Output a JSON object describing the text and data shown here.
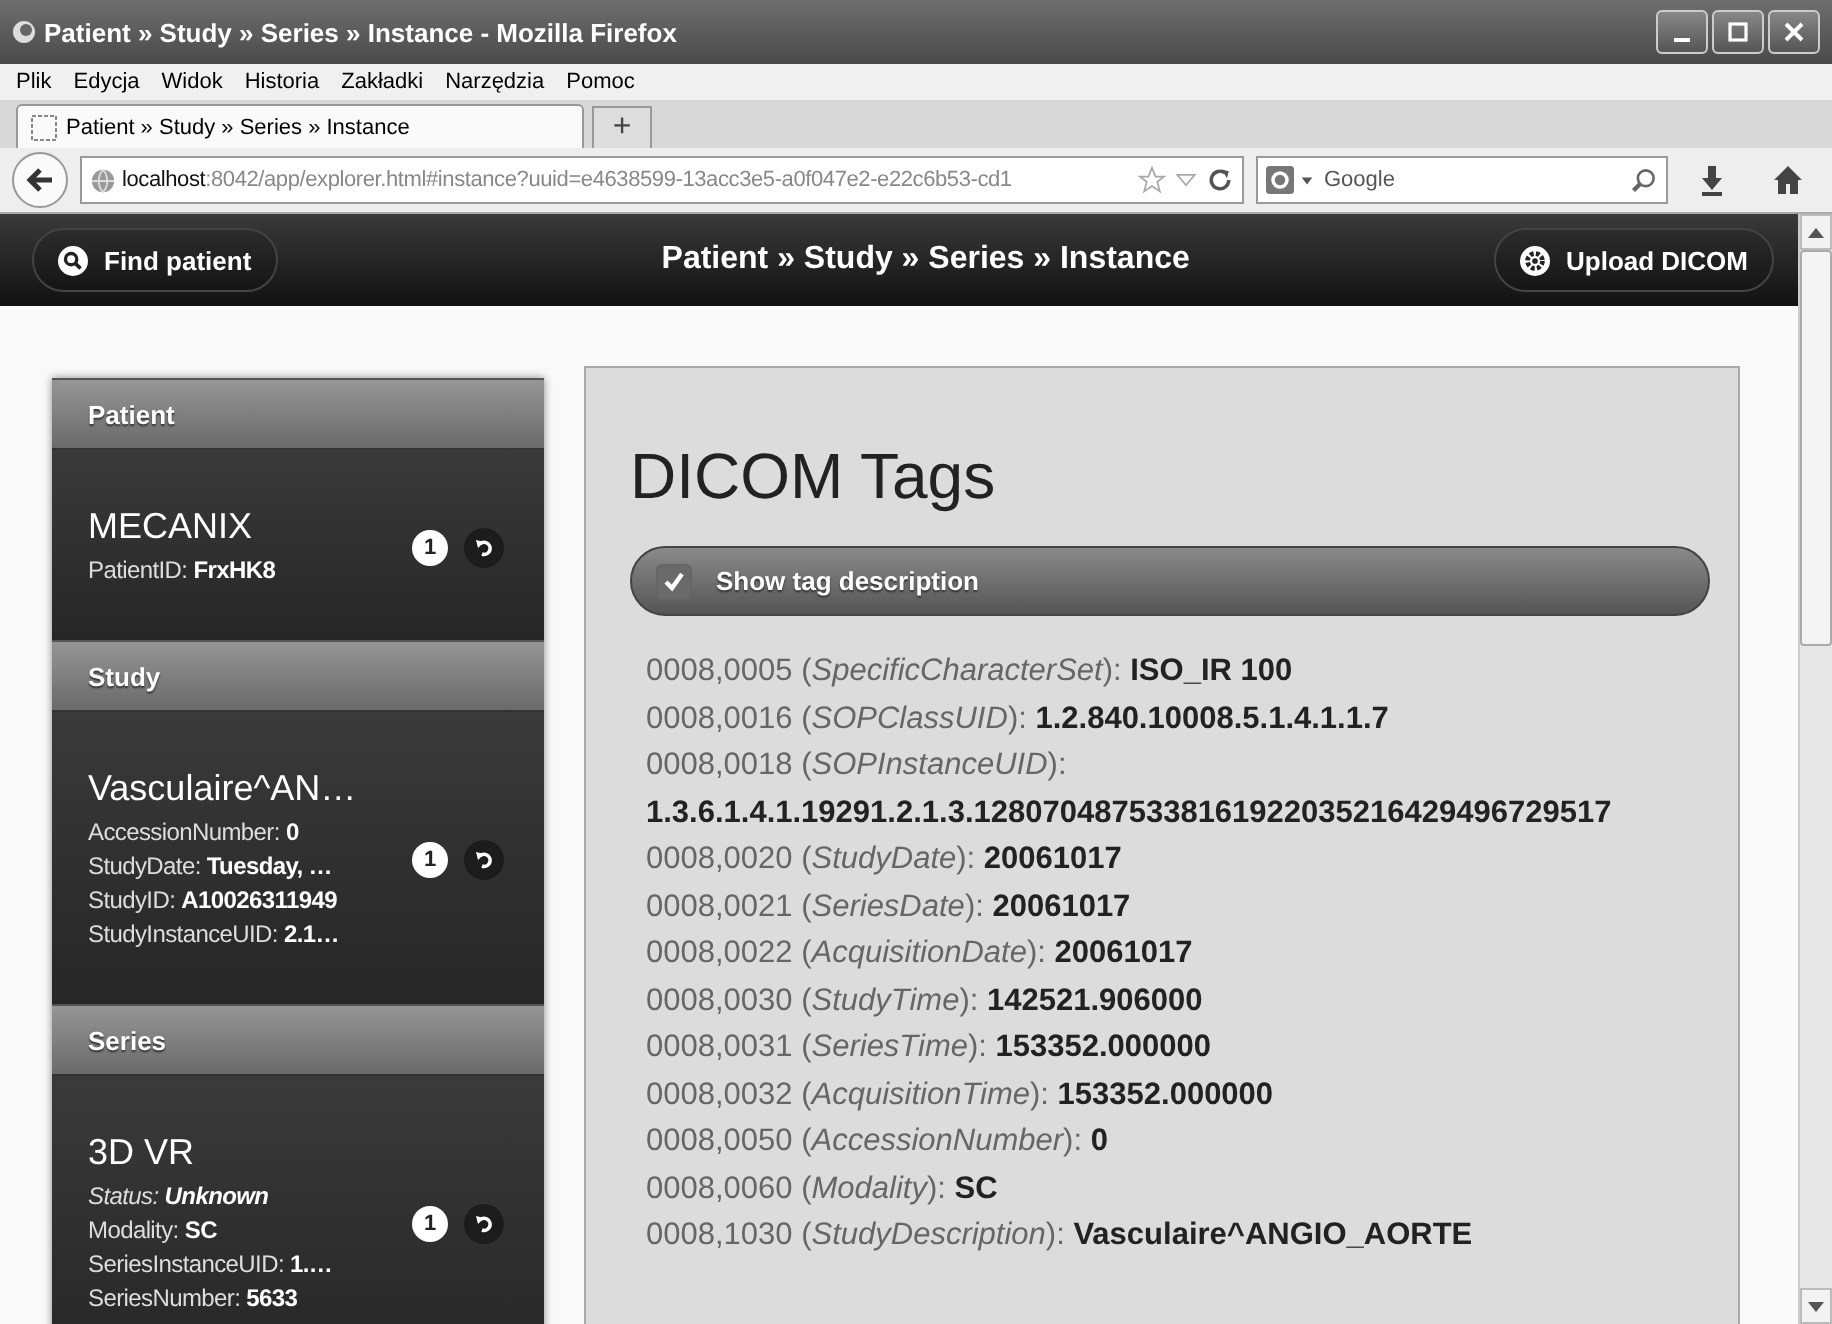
{
  "window": {
    "title": "Patient » Study » Series » Instance - Mozilla Firefox"
  },
  "menu": [
    "Plik",
    "Edycja",
    "Widok",
    "Historia",
    "Zakładki",
    "Narzędzia",
    "Pomoc"
  ],
  "tabs": [
    {
      "label": "Patient » Study » Series » Instance",
      "selected": true
    }
  ],
  "new_tab": "+",
  "address": {
    "host": "localhost",
    "rest": ":8042/app/explorer.html#instance?uuid=e4638599-13acc3e5-a0f047e2-e22c6b53-cd1"
  },
  "search": {
    "placeholder": "Google"
  },
  "header": {
    "find_button": "Find patient",
    "title": "Patient » Study » Series » Instance",
    "upload_button": "Upload DICOM"
  },
  "sidebar": [
    {
      "heading": "Patient",
      "title": "MECANIX",
      "count": "1",
      "fields": [
        {
          "label": "PatientID:",
          "value": "FrxHK8",
          "italic": false
        }
      ]
    },
    {
      "heading": "Study",
      "title": "Vasculaire^AN…",
      "count": "1",
      "fields": [
        {
          "label": "AccessionNumber:",
          "value": "0",
          "italic": false
        },
        {
          "label": "StudyDate:",
          "value": "Tuesday, …",
          "italic": false
        },
        {
          "label": "StudyID:",
          "value": "A10026311949",
          "italic": false
        },
        {
          "label": "StudyInstanceUID:",
          "value": "2.1…",
          "italic": false
        }
      ]
    },
    {
      "heading": "Series",
      "title": "3D VR",
      "count": "1",
      "fields": [
        {
          "label": "Status:",
          "value": "Unknown",
          "italic": true
        },
        {
          "label": "Modality:",
          "value": "SC",
          "italic": false
        },
        {
          "label": "SeriesInstanceUID:",
          "value": "1.…",
          "italic": false
        },
        {
          "label": "SeriesNumber:",
          "value": "5633",
          "italic": false
        }
      ]
    }
  ],
  "main": {
    "title": "DICOM Tags",
    "toggle": {
      "label": "Show tag description",
      "checked": true
    },
    "tags": [
      "0008,0005 (*SpecificCharacterSet*): **ISO_IR 100**",
      "0008,0016 (*SOPClassUID*): **1.2.840.10008.5.1.4.1.1.7**",
      "0008,0018 (*SOPInstanceUID*): **1.3.6.1.4.1.19291.2.1.3.1280704875338161922035216429496729517**",
      "0008,0020 (*StudyDate*): **20061017**",
      "0008,0021 (*SeriesDate*): **20061017**",
      "0008,0022 (*AcquisitionDate*): **20061017**",
      "0008,0030 (*StudyTime*): **142521.906000**",
      "0008,0031 (*SeriesTime*): **153352.000000**",
      "0008,0032 (*AcquisitionTime*): **153352.000000**",
      "0008,0050 (*AccessionNumber*): **0**",
      "0008,0060 (*Modality*): **SC**",
      "0008,1030 (*StudyDescription*): **Vasculaire^ANGIO_AORTE**"
    ]
  }
}
